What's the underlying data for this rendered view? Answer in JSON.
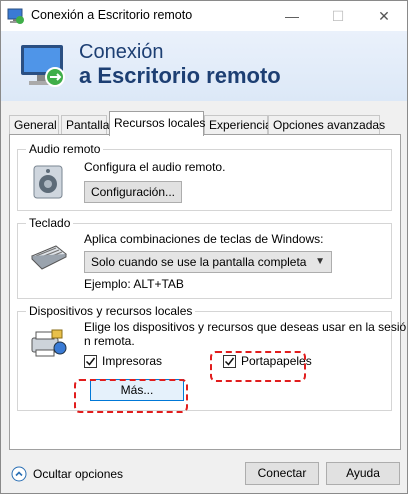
{
  "window": {
    "title": "Conexión a Escritorio remoto",
    "controls": {
      "minimize": "—",
      "maximize": "☐",
      "close": "✕"
    }
  },
  "banner": {
    "line1": "Conexión",
    "line2": "a Escritorio remoto"
  },
  "tabs": [
    {
      "label": "General"
    },
    {
      "label": "Pantalla"
    },
    {
      "label": "Recursos locales",
      "active": true
    },
    {
      "label": "Experiencia"
    },
    {
      "label": "Opciones avanzadas"
    }
  ],
  "audio": {
    "group_label": "Audio remoto",
    "description": "Configura el audio remoto.",
    "button_label": "Configuración..."
  },
  "keyboard": {
    "group_label": "Teclado",
    "description": "Aplica combinaciones de teclas de Windows:",
    "select_value": "Solo cuando se use la pantalla completa",
    "example": "Ejemplo: ALT+TAB"
  },
  "devices": {
    "group_label": "Dispositivos y recursos locales",
    "description_line1": "Elige los dispositivos y recursos que deseas usar en la sesió",
    "description_line2": "n remota.",
    "printers_label": "Impresoras",
    "printers_checked": true,
    "clipboard_label": "Portapapeles",
    "clipboard_checked": true,
    "more_button": "Más..."
  },
  "footer": {
    "hide_options": "Ocultar opciones",
    "connect": "Conectar",
    "help": "Ayuda"
  },
  "colors": {
    "banner_text": "#1d3f73",
    "highlight": "#e11d1d"
  }
}
